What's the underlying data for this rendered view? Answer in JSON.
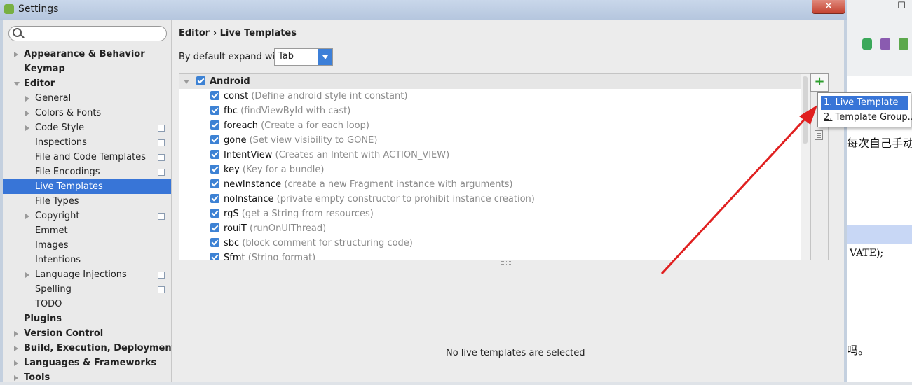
{
  "window": {
    "title": "Settings",
    "close_label": "✕"
  },
  "background_app": {
    "text_line1": "每次自己手动",
    "text_line2": "VATE);",
    "text_line3": "吗。",
    "minimize_label": "—",
    "maximize_label": "☐"
  },
  "sidebar": {
    "search_placeholder": "",
    "items": [
      {
        "label": "Appearance & Behavior",
        "level": 0,
        "bold": true,
        "arrow": "right"
      },
      {
        "label": "Keymap",
        "level": 0,
        "bold": true,
        "arrow": "none"
      },
      {
        "label": "Editor",
        "level": 0,
        "bold": true,
        "arrow": "down"
      },
      {
        "label": "General",
        "level": 1,
        "arrow": "right"
      },
      {
        "label": "Colors & Fonts",
        "level": 1,
        "arrow": "right"
      },
      {
        "label": "Code Style",
        "level": 1,
        "arrow": "right",
        "copy_icon": true
      },
      {
        "label": "Inspections",
        "level": 1,
        "copy_icon": true
      },
      {
        "label": "File and Code Templates",
        "level": 1,
        "copy_icon": true
      },
      {
        "label": "File Encodings",
        "level": 1,
        "copy_icon": true
      },
      {
        "label": "Live Templates",
        "level": 1,
        "selected": true
      },
      {
        "label": "File Types",
        "level": 1
      },
      {
        "label": "Copyright",
        "level": 1,
        "arrow": "right",
        "copy_icon": true
      },
      {
        "label": "Emmet",
        "level": 1
      },
      {
        "label": "Images",
        "level": 1
      },
      {
        "label": "Intentions",
        "level": 1
      },
      {
        "label": "Language Injections",
        "level": 1,
        "arrow": "right",
        "copy_icon": true
      },
      {
        "label": "Spelling",
        "level": 1,
        "copy_icon": true
      },
      {
        "label": "TODO",
        "level": 1
      },
      {
        "label": "Plugins",
        "level": 0,
        "bold": true
      },
      {
        "label": "Version Control",
        "level": 0,
        "bold": true,
        "arrow": "right"
      },
      {
        "label": "Build, Execution, Deployment",
        "level": 0,
        "bold": true,
        "arrow": "right"
      },
      {
        "label": "Languages & Frameworks",
        "level": 0,
        "bold": true,
        "arrow": "right"
      },
      {
        "label": "Tools",
        "level": 0,
        "bold": true,
        "arrow": "right"
      }
    ]
  },
  "main": {
    "breadcrumb": "Editor › Live Templates",
    "expand_label": "By default expand with",
    "expand_value": "Tab",
    "group": {
      "name": "Android"
    },
    "templates": [
      {
        "abbr": "const",
        "desc": "(Define android style int constant)"
      },
      {
        "abbr": "fbc",
        "desc": "(findViewById with cast)"
      },
      {
        "abbr": "foreach",
        "desc": "(Create a for each loop)"
      },
      {
        "abbr": "gone",
        "desc": "(Set view visibility to GONE)"
      },
      {
        "abbr": "IntentView",
        "desc": "(Creates an Intent with ACTION_VIEW)"
      },
      {
        "abbr": "key",
        "desc": "(Key for a bundle)"
      },
      {
        "abbr": "newInstance",
        "desc": "(create a new Fragment instance with arguments)"
      },
      {
        "abbr": "noInstance",
        "desc": "(private empty constructor to prohibit instance creation)"
      },
      {
        "abbr": "rgS",
        "desc": "(get a String from resources)"
      },
      {
        "abbr": "rouiT",
        "desc": "(runOnUIThread)"
      },
      {
        "abbr": "sbc",
        "desc": "(block comment for structuring code)"
      },
      {
        "abbr": "Sfmt",
        "desc": "(String format)"
      }
    ],
    "no_selection_text": "No live templates are selected",
    "add_button_label": "+"
  },
  "popup": {
    "items": [
      {
        "num": "1.",
        "label": " Live Template"
      },
      {
        "num": "2.",
        "label": " Template Group..."
      }
    ]
  },
  "colors": {
    "selection": "#3875d7",
    "checkbox": "#3d82d4",
    "arrow_annotation": "#e02020"
  }
}
